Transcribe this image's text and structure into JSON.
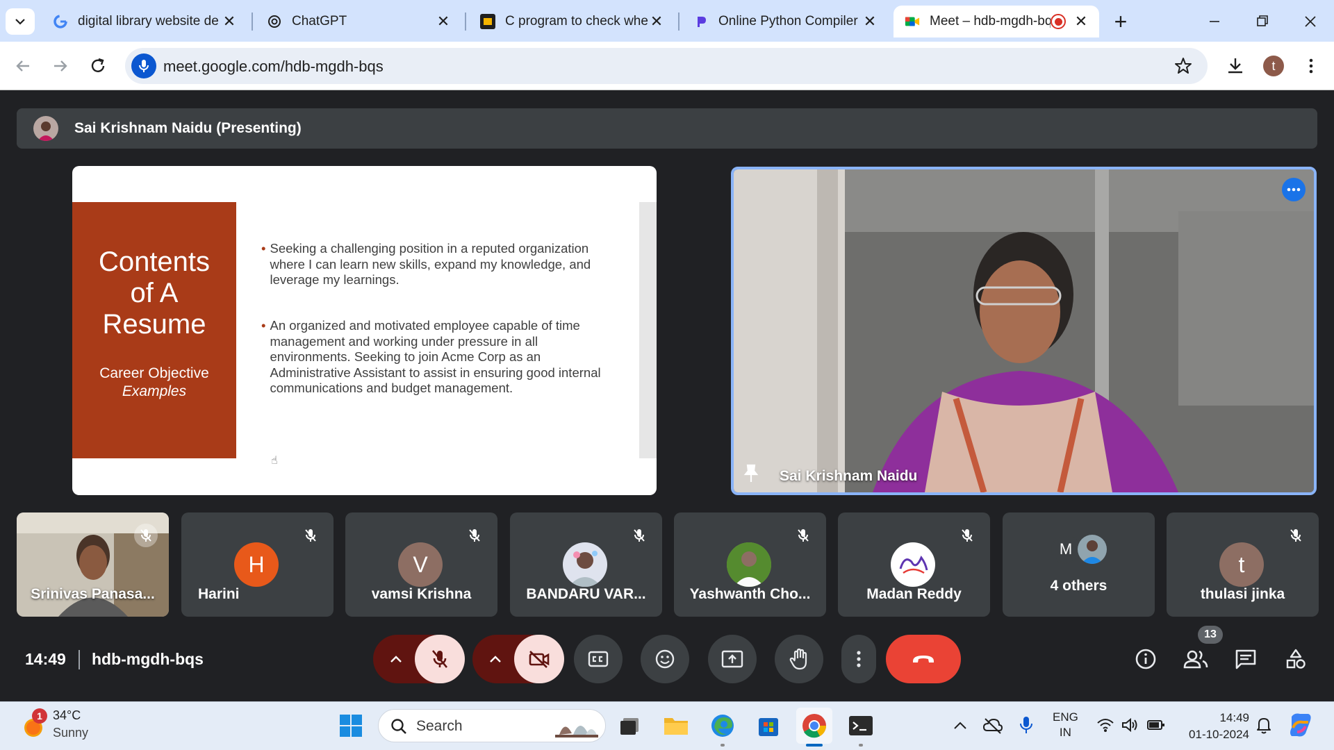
{
  "browser": {
    "tabs": [
      {
        "title": "digital library website de",
        "icon": "google-icon"
      },
      {
        "title": "ChatGPT",
        "icon": "chatgpt-icon"
      },
      {
        "title": "C program to check whet",
        "icon": "geeks-icon"
      },
      {
        "title": "Online Python Compiler (",
        "icon": "programiz-icon"
      },
      {
        "title": "Meet – hdb-mgdh-bq",
        "icon": "meet-icon",
        "active": true
      }
    ],
    "url": "meet.google.com/hdb-mgdh-bqs",
    "profile_initial": "t"
  },
  "meet": {
    "presenter_label": "Sai Krishnam Naidu (Presenting)",
    "slide": {
      "title_lines": [
        "Contents",
        "of A",
        "Resume"
      ],
      "subtitle": "Career Objective",
      "subtitle_italic": "Examples",
      "bullets": [
        "Seeking a challenging position in a reputed organization where I can learn new skills, expand my knowledge, and leverage my learnings.",
        "An organized and motivated employee capable of time management and working under pressure in all environments. Seeking to join Acme Corp as an Administrative Assistant to assist in ensuring good internal communications and budget management."
      ]
    },
    "main_speaker": "Sai Krishnam Naidu",
    "participants": [
      {
        "name": "Srinivas Panasa...",
        "kind": "video"
      },
      {
        "name": "Harini",
        "initial": "H",
        "color": "#e8591a"
      },
      {
        "name": "vamsi Krishna",
        "initial": "V",
        "color": "#8d6e63"
      },
      {
        "name": "BANDARU VAR...",
        "kind": "photo"
      },
      {
        "name": "Yashwanth Cho...",
        "kind": "photo"
      },
      {
        "name": "Madan Reddy",
        "kind": "logo"
      },
      {
        "name": "4 others",
        "initial": "M"
      },
      {
        "name": "thulasi jinka",
        "initial": "t",
        "color": "#8d6e63"
      }
    ],
    "time": "14:49",
    "meeting_code": "hdb-mgdh-bqs",
    "participant_count": "13",
    "colors": {
      "end_call": "#ea4335",
      "mic_off_bg": "#f9dedc",
      "mic_toggle_bg": "#601410",
      "accent": "#8ab4f8"
    }
  },
  "taskbar": {
    "weather_temp": "34°C",
    "weather_desc": "Sunny",
    "weather_badge": "1",
    "search_placeholder": "Search",
    "lang_top": "ENG",
    "lang_bottom": "IN",
    "clock_time": "14:49",
    "clock_date": "01-10-2024"
  }
}
